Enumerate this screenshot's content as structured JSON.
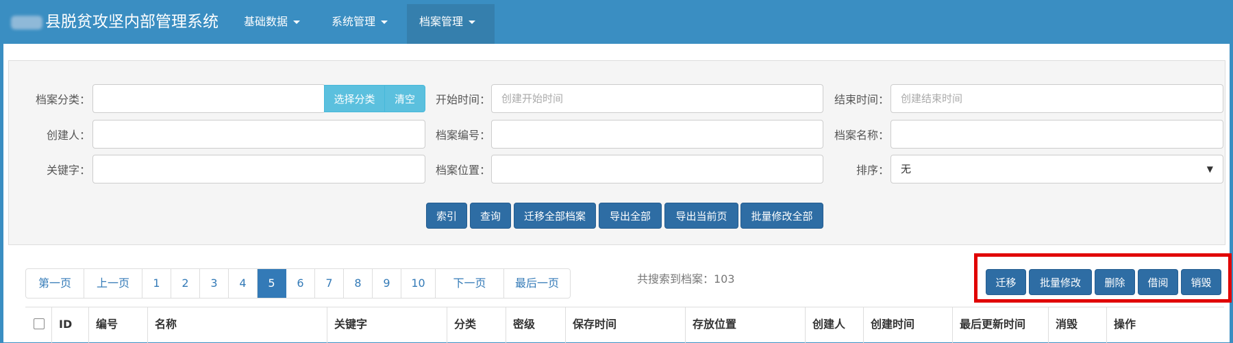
{
  "header": {
    "brand_suffix": "县脱贫攻坚内部管理系统",
    "nav": [
      {
        "label": "基础数据"
      },
      {
        "label": "系统管理"
      },
      {
        "label": "档案管理"
      }
    ]
  },
  "filters": {
    "category_label": "档案分类：",
    "category_value": "",
    "select_category": "选择分类",
    "clear": "清空",
    "start_label": "开始时间：",
    "start_placeholder": "创建开始时间",
    "end_label": "结束时间：",
    "end_placeholder": "创建结束时间",
    "creator_label": "创建人：",
    "creator_value": "",
    "code_label": "档案编号：",
    "code_value": "",
    "name_label": "档案名称：",
    "name_value": "",
    "keyword_label": "关键字：",
    "keyword_value": "",
    "location_label": "档案位置：",
    "location_value": "",
    "sort_label": "排序：",
    "sort_value": "无"
  },
  "actions": [
    "索引",
    "查询",
    "迁移全部档案",
    "导出全部",
    "导出当前页",
    "批量修改全部"
  ],
  "pagination": {
    "first": "第一页",
    "prev": "上一页",
    "pages": [
      "1",
      "2",
      "3",
      "4",
      "5",
      "6",
      "7",
      "8",
      "9",
      "10"
    ],
    "current": "5",
    "next": "下一页",
    "last": "最后一页"
  },
  "total_text": "共搜索到档案：103",
  "row_actions": [
    "迁移",
    "批量修改",
    "删除",
    "借阅",
    "销毁"
  ],
  "table": {
    "headers": [
      "ID",
      "编号",
      "名称",
      "关键字",
      "分类",
      "密级",
      "保存时间",
      "存放位置",
      "创建人",
      "创建时间",
      "最后更新时间",
      "消毁",
      "操作"
    ]
  },
  "colors": {
    "navbar": "#3a8ec2",
    "primary": "#2e6da4",
    "info": "#5bc0de",
    "highlight": "#e00000"
  }
}
